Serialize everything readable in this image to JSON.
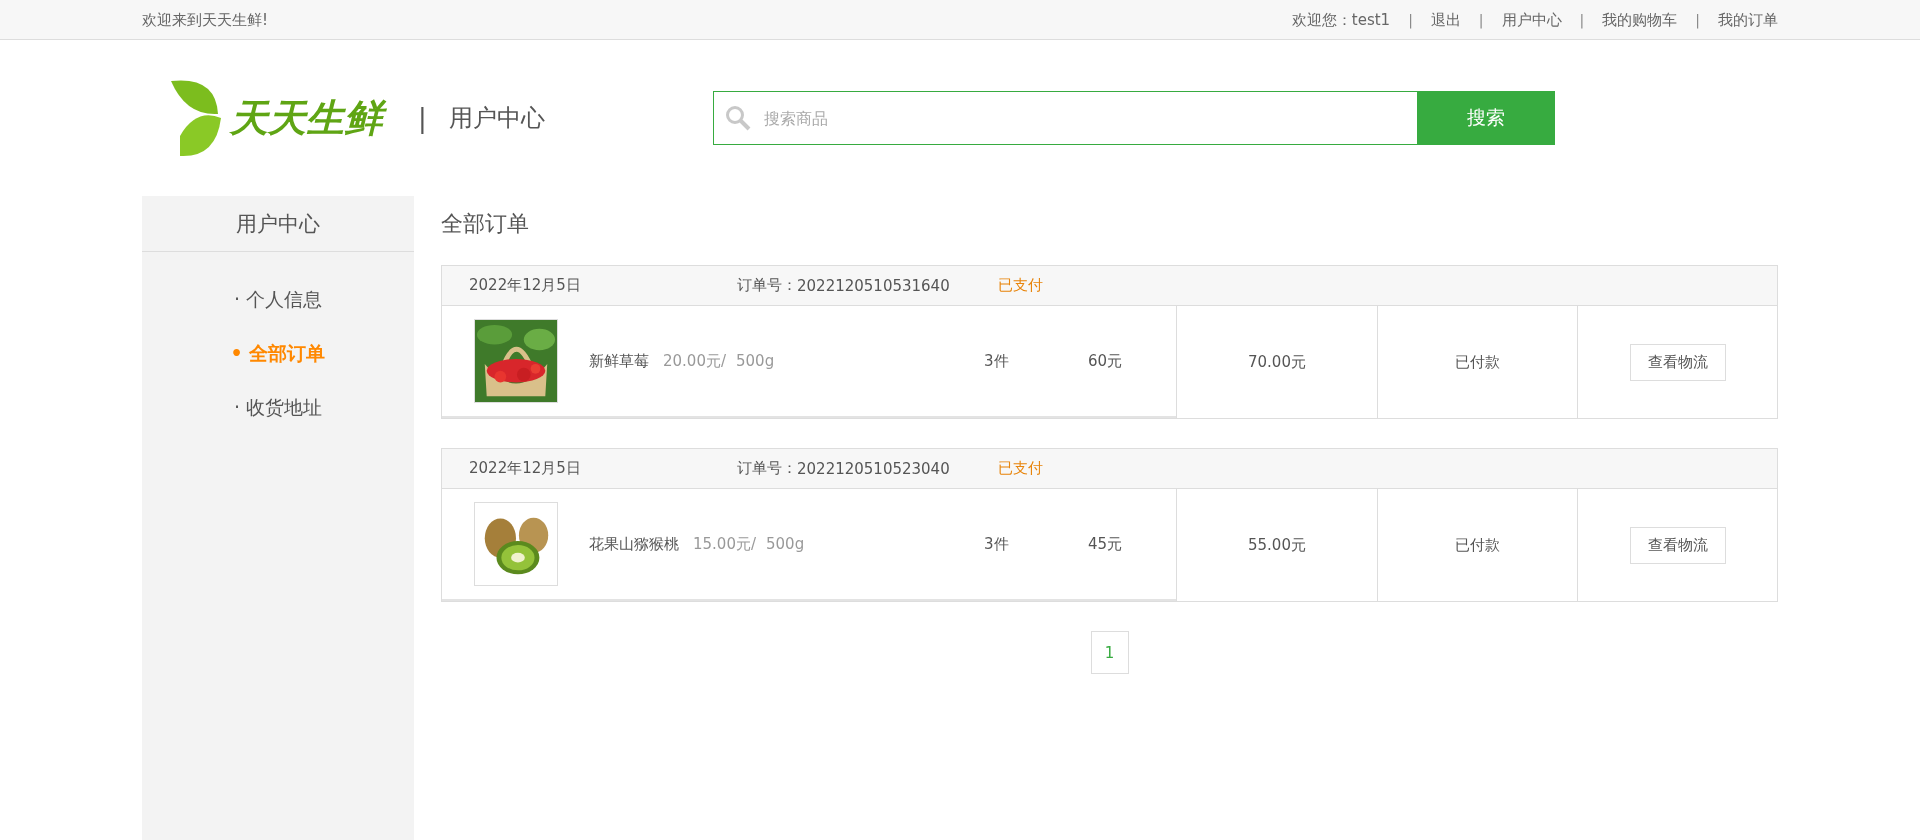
{
  "top_bar": {
    "welcome": "欢迎来到天天生鲜!",
    "user_greeting": "欢迎您：",
    "username": "test1",
    "links": [
      "退出",
      "用户中心",
      "我的购物车",
      "我的订单"
    ],
    "separator": "|"
  },
  "header": {
    "logo_text": "天天生鲜",
    "divider": "|",
    "section_title": "用户中心",
    "search": {
      "placeholder": "搜索商品",
      "button": "搜索"
    }
  },
  "sidebar": {
    "title": "用户中心",
    "items": [
      {
        "label": "· 个人信息",
        "selected": false
      },
      {
        "label": "• 全部订单",
        "selected": true
      },
      {
        "label": "· 收货地址",
        "selected": false
      }
    ]
  },
  "main": {
    "title": "全部订单",
    "orders": [
      {
        "date": "2022年12月5日",
        "order_no_label": "订单号：",
        "order_no": "2022120510531640",
        "status": "已支付",
        "product": {
          "kind": "strawberry",
          "name": "新鲜草莓",
          "price": "20.00元/",
          "unit": "500g",
          "quantity": "3件",
          "subtotal": "60元"
        },
        "total": "70.00元",
        "payment": "已付款",
        "action": "查看物流"
      },
      {
        "date": "2022年12月5日",
        "order_no_label": "订单号：",
        "order_no": "2022120510523040",
        "status": "已支付",
        "product": {
          "kind": "kiwi",
          "name": "花果山猕猴桃",
          "price": "15.00元/",
          "unit": "500g",
          "quantity": "3件",
          "subtotal": "45元"
        },
        "total": "55.00元",
        "payment": "已付款",
        "action": "查看物流"
      }
    ],
    "pagination": [
      {
        "label": "1",
        "selected": true
      }
    ]
  }
}
